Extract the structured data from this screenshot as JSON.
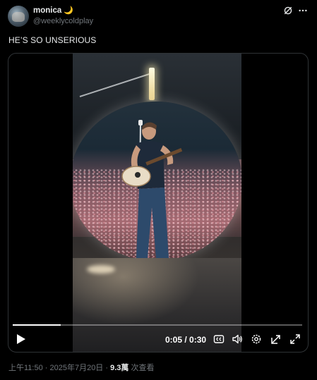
{
  "author": {
    "name": "monica",
    "name_emoji": "🌙",
    "handle": "@weeklycoldplay"
  },
  "post": {
    "text": "HE’S SO UNSERIOUS"
  },
  "video": {
    "time_display": "0:05 / 0:30",
    "progress_fraction": 0.167
  },
  "meta": {
    "timestamp": "上午11:50 · 2025年7月20日 · ",
    "views_count": "9.3萬",
    "views_label": " 次查看"
  },
  "icons": {
    "top_right": [
      "grok-icon",
      "more-icon"
    ],
    "controls": [
      "play-icon",
      "cc-icon",
      "volume-icon",
      "settings-icon",
      "pip-icon",
      "fullscreen-icon"
    ]
  },
  "colors": {
    "background": "#000000",
    "text_primary": "#e7e9ea",
    "text_secondary": "#71767b",
    "border": "#2f3336"
  }
}
